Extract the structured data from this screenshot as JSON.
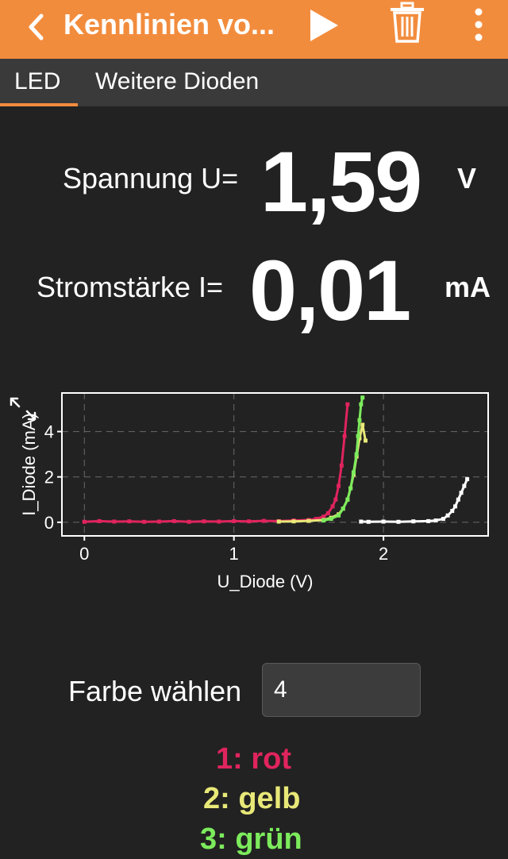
{
  "appbar": {
    "title": "Kennlinien vo...",
    "icons": [
      "chevron-left-icon",
      "play-icon",
      "trash-icon",
      "more-vertical-icon"
    ],
    "color": "#F28C3D"
  },
  "tabs": [
    {
      "label": "LED",
      "selected": true
    },
    {
      "label": "Weitere Dioden",
      "selected": false
    }
  ],
  "readouts": {
    "voltage": {
      "label": "Spannung U=",
      "value": "1,59",
      "unit": "V"
    },
    "current": {
      "label": "Stromstärke I=",
      "value": "0,01",
      "unit": "mA"
    }
  },
  "chart_data": {
    "type": "scatter",
    "xlabel": "U_Diode (V)",
    "ylabel": "I_Diode (mA)",
    "xlim": [
      -0.15,
      2.7
    ],
    "ylim": [
      -0.6,
      5.7
    ],
    "xticks": [
      "0",
      "1",
      "2"
    ],
    "yticks": [
      "0",
      "2",
      "4"
    ],
    "grid": true,
    "series": [
      {
        "color": "#E0245E",
        "x": [
          0.0,
          0.1,
          0.2,
          0.3,
          0.4,
          0.5,
          0.6,
          0.7,
          0.8,
          0.9,
          1.0,
          1.1,
          1.2,
          1.3,
          1.4,
          1.5,
          1.55,
          1.6,
          1.63,
          1.66,
          1.68,
          1.7,
          1.72,
          1.74,
          1.76
        ],
        "y": [
          0.02,
          0.05,
          0.03,
          0.04,
          0.02,
          0.03,
          0.05,
          0.02,
          0.04,
          0.03,
          0.05,
          0.04,
          0.06,
          0.05,
          0.08,
          0.1,
          0.15,
          0.25,
          0.4,
          0.7,
          1.0,
          1.6,
          2.5,
          3.8,
          5.2
        ]
      },
      {
        "color": "#E8E878",
        "x": [
          1.3,
          1.4,
          1.5,
          1.6,
          1.65,
          1.7,
          1.73,
          1.76,
          1.78,
          1.8,
          1.82,
          1.84,
          1.86,
          1.88
        ],
        "y": [
          0.03,
          0.04,
          0.06,
          0.1,
          0.2,
          0.35,
          0.6,
          1.0,
          1.5,
          2.1,
          2.9,
          3.7,
          4.3,
          3.6
        ]
      },
      {
        "color": "#7CEB5C",
        "x": [
          1.6,
          1.65,
          1.7,
          1.73,
          1.76,
          1.78,
          1.8,
          1.82,
          1.83,
          1.84,
          1.85,
          1.86
        ],
        "y": [
          0.08,
          0.15,
          0.3,
          0.6,
          1.0,
          1.5,
          2.2,
          3.0,
          3.8,
          4.5,
          5.2,
          5.5
        ]
      },
      {
        "color": "#FFFFFF",
        "x": [
          1.85,
          1.9,
          2.0,
          2.1,
          2.2,
          2.3,
          2.35,
          2.4,
          2.43,
          2.46,
          2.48,
          2.5,
          2.52,
          2.54,
          2.56
        ],
        "y": [
          0.03,
          0.02,
          0.03,
          0.02,
          0.04,
          0.05,
          0.08,
          0.15,
          0.3,
          0.5,
          0.7,
          1.0,
          1.3,
          1.6,
          1.9
        ]
      }
    ]
  },
  "color_picker": {
    "label": "Farbe wählen",
    "value": "4",
    "options": [
      {
        "label": "1: rot",
        "color": "#E0245E"
      },
      {
        "label": "2: gelb",
        "color": "#E8E878"
      },
      {
        "label": "3: grün",
        "color": "#7CEB5C"
      }
    ]
  }
}
